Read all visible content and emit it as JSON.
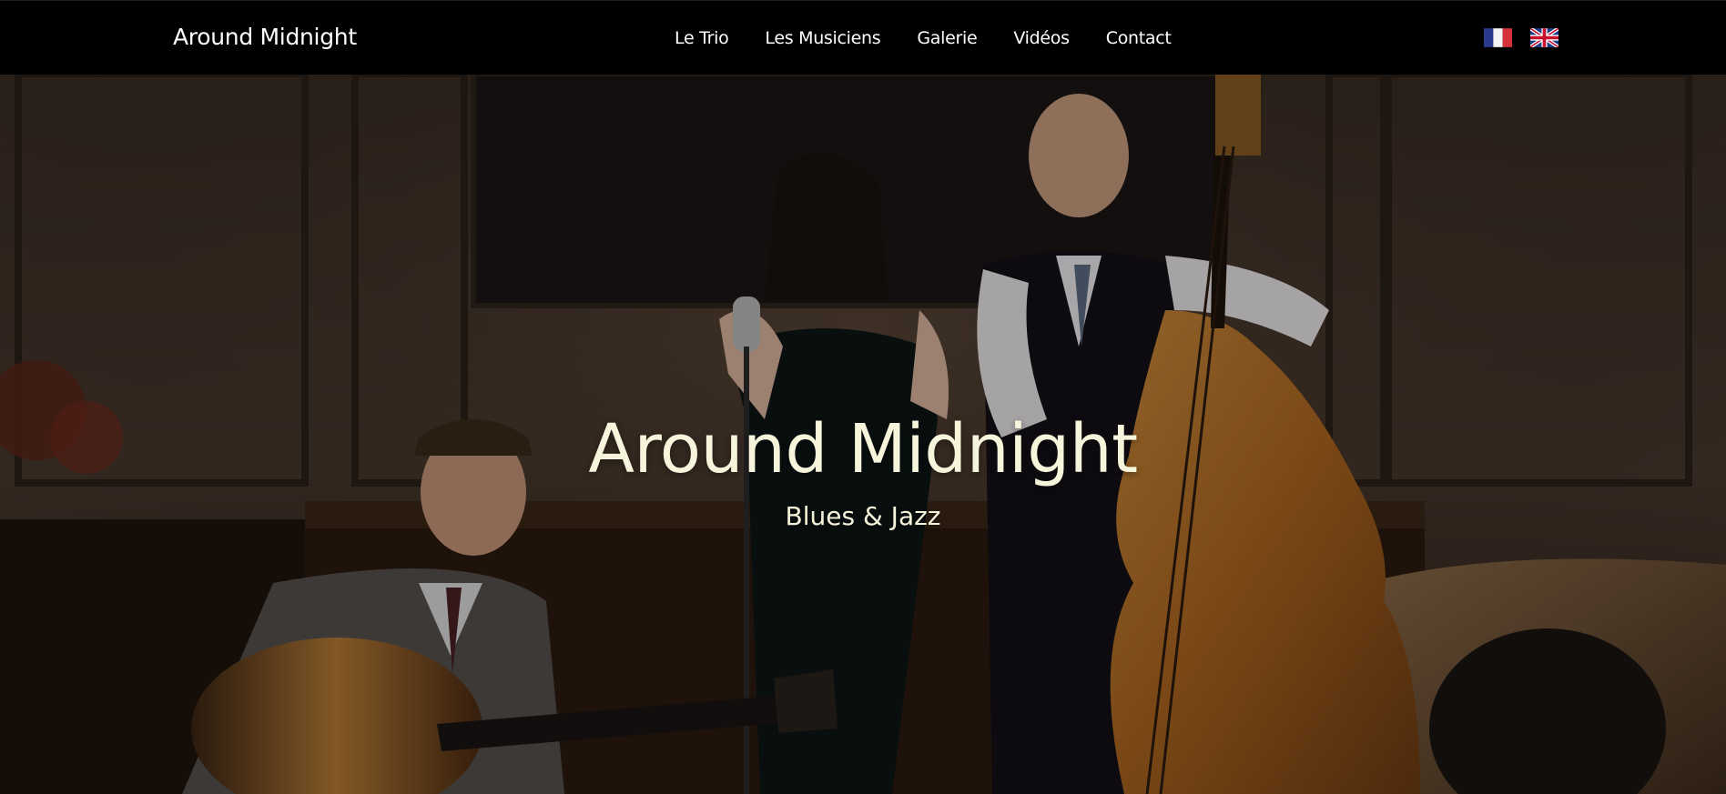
{
  "navbar": {
    "brand": "Around Midnight",
    "links": [
      {
        "label": "Le Trio"
      },
      {
        "label": "Les Musiciens"
      },
      {
        "label": "Galerie"
      },
      {
        "label": "Vidéos"
      },
      {
        "label": "Contact"
      }
    ],
    "languages": [
      {
        "icon": "flag-france-icon",
        "lang": "fr"
      },
      {
        "icon": "flag-uk-icon",
        "lang": "en"
      }
    ]
  },
  "hero": {
    "title": "Around Midnight",
    "subtitle": "Blues & Jazz",
    "image": "band-photo"
  },
  "colors": {
    "navbar_bg": "#000000",
    "nav_text": "#ffffff",
    "hero_text": "#f7f4dc"
  }
}
